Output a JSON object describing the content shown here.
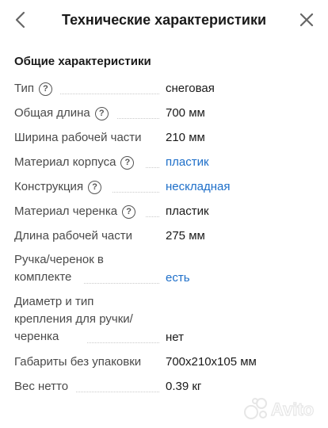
{
  "header": {
    "title": "Технические характеристики",
    "back_icon": "chevron-left-icon",
    "close_icon": "close-icon"
  },
  "section": {
    "title": "Общие характеристики"
  },
  "specs": [
    {
      "label": "Тип",
      "value": "снеговая",
      "help": "?",
      "link": false
    },
    {
      "label": "Общая длина",
      "value": "700 мм",
      "help": "?",
      "link": false
    },
    {
      "label": "Ширина рабочей части",
      "value": "210 мм",
      "link": false
    },
    {
      "label": "Материал корпуса",
      "value": "пластик",
      "help": "?",
      "link": true
    },
    {
      "label": "Конструкция",
      "value": "нескладная",
      "help": "?",
      "link": true
    },
    {
      "label": "Материал черенка",
      "value": "пластик",
      "help": "?",
      "link": false
    },
    {
      "label": "Длина рабочей части",
      "value": "275 мм",
      "link": false
    },
    {
      "label": "Ручка/черенок в комплекте",
      "value": "есть",
      "link": true
    },
    {
      "label": "Диаметр и тип крепления для ручки/черенка",
      "value": "нет",
      "link": false
    },
    {
      "label": "Габариты без упаковки",
      "value": "700x210x105 мм",
      "link": false
    },
    {
      "label": "Вес нетто",
      "value": "0.39 кг",
      "link": false
    }
  ],
  "watermark": {
    "text": "Avito"
  },
  "colors": {
    "link": "#1e6fc9",
    "label": "#4a4a4a",
    "value": "#1a1a1a"
  }
}
